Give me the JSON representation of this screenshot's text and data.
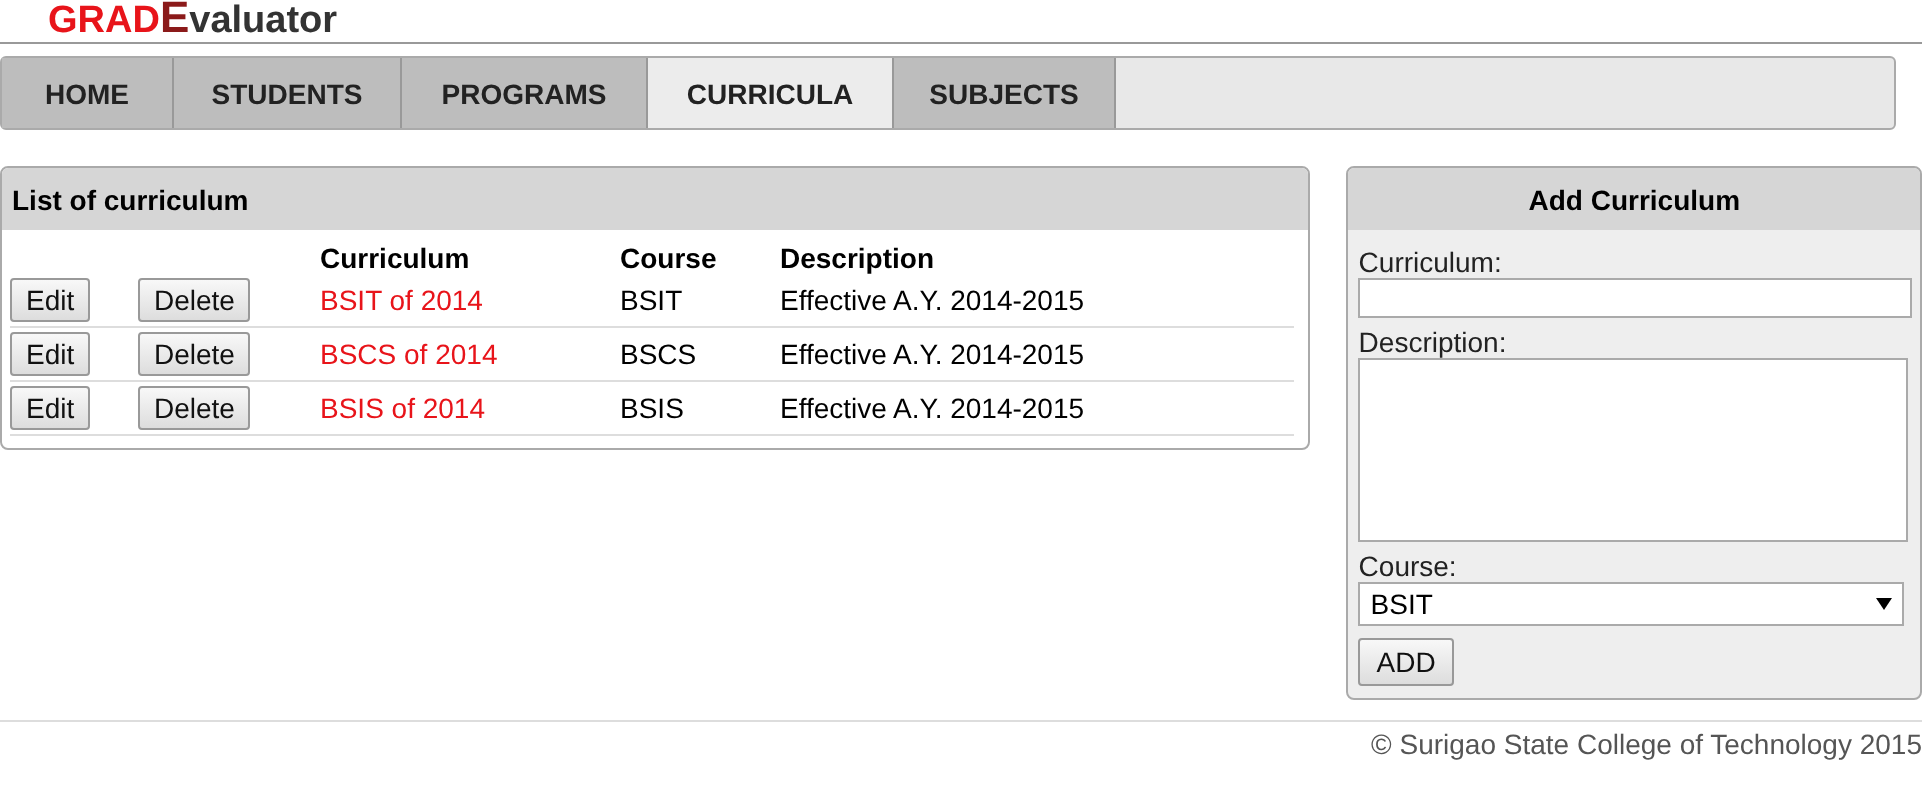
{
  "logo": {
    "part_1": "GRAD",
    "part_2": "E",
    "part_3": "valuator"
  },
  "nav": [
    {
      "label": "HOME",
      "selected": false
    },
    {
      "label": "STUDENTS",
      "selected": false
    },
    {
      "label": "PROGRAMS",
      "selected": false
    },
    {
      "label": "CURRICULA",
      "selected": true
    },
    {
      "label": "SUBJECTS",
      "selected": false
    }
  ],
  "list_panel": {
    "title": "List of curriculum",
    "columns": [
      "Curriculum",
      "Course",
      "Description"
    ],
    "rows": [
      {
        "edit": "Edit",
        "delete": "Delete",
        "curriculum": "BSIT of 2014",
        "course": "BSIT",
        "description": "Effective A.Y. 2014-2015"
      },
      {
        "edit": "Edit",
        "delete": "Delete",
        "curriculum": "BSCS of 2014",
        "course": "BSCS",
        "description": "Effective A.Y. 2014-2015"
      },
      {
        "edit": "Edit",
        "delete": "Delete",
        "curriculum": "BSIS of 2014",
        "course": "BSIS",
        "description": "Effective A.Y. 2014-2015"
      }
    ]
  },
  "add_panel": {
    "title": "Add Curriculum",
    "curriculum_label": "Curriculum:",
    "description_label": "Description:",
    "course_label": "Course:",
    "course_value": "BSIT",
    "button": "ADD"
  },
  "footer": "© Surigao State College of Technology 2015"
}
